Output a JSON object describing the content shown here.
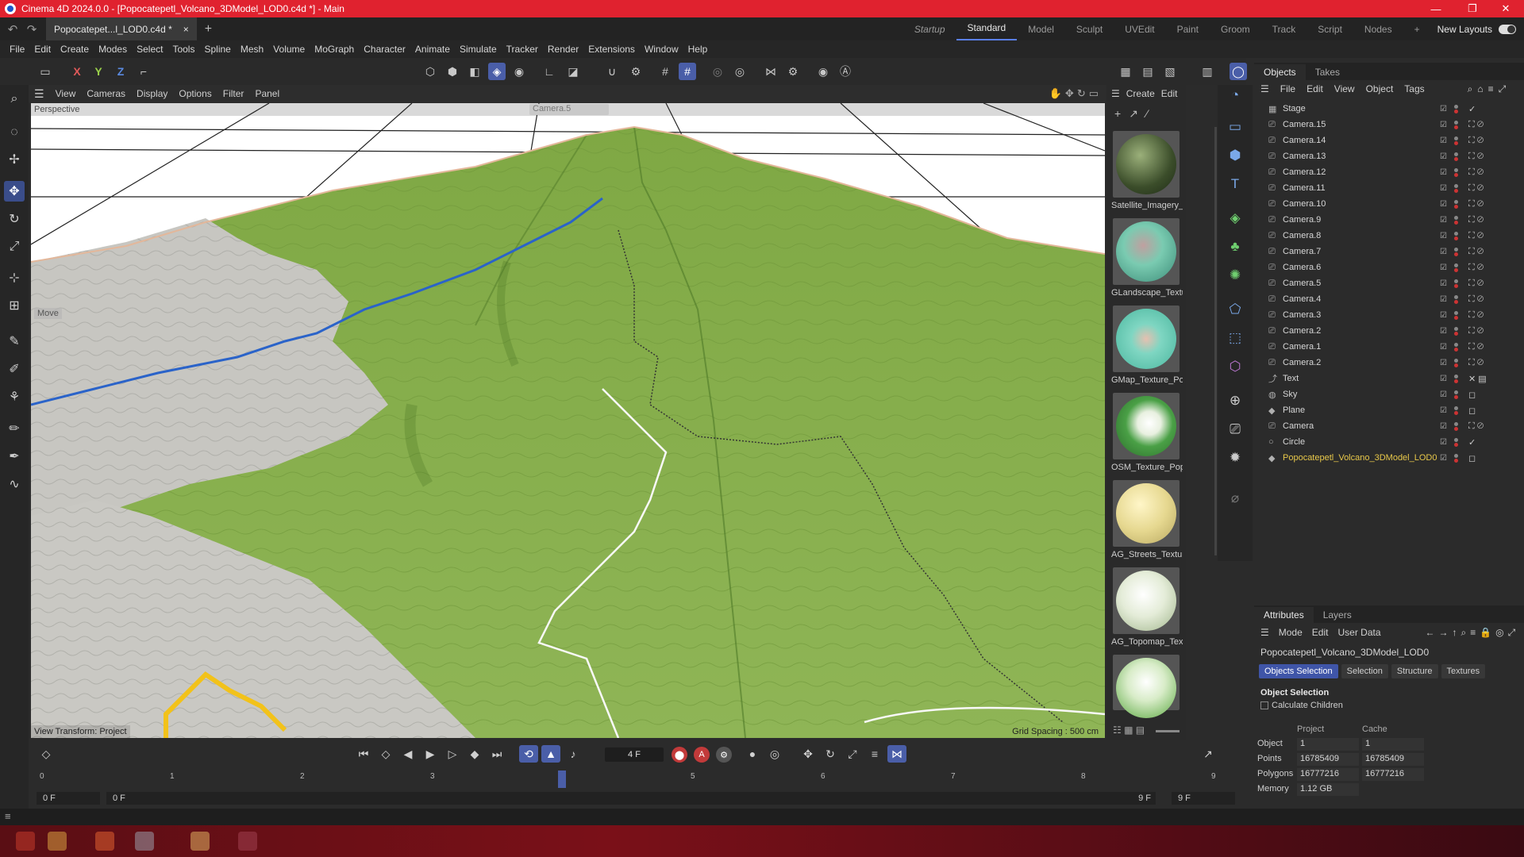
{
  "window": {
    "title": "Cinema 4D 2024.0.0 - [Popocatepetl_Volcano_3DModel_LOD0.c4d *] - Main"
  },
  "doc_tab": {
    "label": "Popocatepet...l_LOD0.c4d *",
    "close": "×"
  },
  "layouts": {
    "tabs": [
      "Startup",
      "Standard",
      "Model",
      "Sculpt",
      "UVEdit",
      "Paint",
      "Groom",
      "Track",
      "Script",
      "Nodes"
    ],
    "active": "Standard",
    "new_layouts": "New Layouts",
    "plus": "+"
  },
  "menu": [
    "File",
    "Edit",
    "Create",
    "Modes",
    "Select",
    "Tools",
    "Spline",
    "Mesh",
    "Volume",
    "MoGraph",
    "Character",
    "Animate",
    "Simulate",
    "Tracker",
    "Render",
    "Extensions",
    "Window",
    "Help"
  ],
  "toolbar": {
    "x": "X",
    "y": "Y",
    "z": "Z"
  },
  "viewport_menu": [
    "View",
    "Cameras",
    "Display",
    "Options",
    "Filter",
    "Panel"
  ],
  "viewport": {
    "perspective": "Perspective",
    "camera": "Camera.5",
    "move": "Move",
    "view_transform": "View Transform: Project",
    "grid_spacing": "Grid Spacing : 500 cm"
  },
  "material_panel": {
    "menu": [
      "Create",
      "Edit"
    ],
    "materials": [
      "Satellite_Imagery_",
      "GLandscape_Textu",
      "GMap_Texture_Po",
      "OSM_Texture_Pop",
      "AG_Streets_Textur",
      "AG_Topomap_Tex",
      ""
    ]
  },
  "objects_panel": {
    "tabs": [
      "Objects",
      "Takes"
    ],
    "menu": [
      "File",
      "Edit",
      "View",
      "Object",
      "Tags"
    ],
    "items": [
      "Stage",
      "Camera.15",
      "Camera.14",
      "Camera.13",
      "Camera.12",
      "Camera.11",
      "Camera.10",
      "Camera.9",
      "Camera.8",
      "Camera.7",
      "Camera.6",
      "Camera.5",
      "Camera.4",
      "Camera.3",
      "Camera.2",
      "Camera.1",
      "Camera.2",
      "Text",
      "Sky",
      "Plane",
      "Camera",
      "Circle",
      "Popocatepetl_Volcano_3DModel_LOD0"
    ],
    "highlight_color": "#e8c84a"
  },
  "attributes": {
    "tabs": [
      "Attributes",
      "Layers"
    ],
    "menu": [
      "Mode",
      "Edit",
      "User Data"
    ],
    "path": "Popocatepetl_Volcano_3DModel_LOD0",
    "buttons": [
      "Objects Selection",
      "Selection",
      "Structure",
      "Textures"
    ],
    "section": "Object Selection",
    "calculate_children": "Calculate Children",
    "columns": [
      "Project",
      "Cache"
    ],
    "rows": [
      {
        "label": "Object",
        "project": "1",
        "cache": "1"
      },
      {
        "label": "Points",
        "project": "16785409",
        "cache": "16785409"
      },
      {
        "label": "Polygons",
        "project": "16777216",
        "cache": "16777216"
      },
      {
        "label": "Memory",
        "project": "1.12 GB",
        "cache": ""
      }
    ]
  },
  "timeline": {
    "current_frame": "4 F",
    "ticks": [
      "0",
      "1",
      "2",
      "3",
      "4",
      "5",
      "6",
      "7",
      "8",
      "9"
    ],
    "start": "0 F",
    "start2": "0 F",
    "end": "9 F",
    "end2": "9 F"
  },
  "colors": {
    "accent": "#4a5ea8",
    "titlebar": "#e0222f",
    "terrain_green": "#86ad4a"
  }
}
